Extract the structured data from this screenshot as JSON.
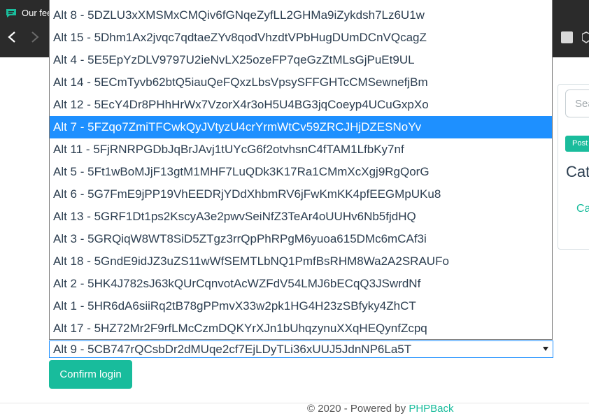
{
  "browser": {
    "tab_title": "Our fee",
    "back_icon": "back-arrow-icon",
    "forward_icon": "forward-arrow-icon"
  },
  "sidebar": {
    "search_placeholder": "Sea",
    "post_button_label": "Post",
    "heading": "Cat",
    "link_text": "Ca"
  },
  "login_select": {
    "options": [
      "Alt 8 - 5DZLU3xXMSMxCMQiv6fGNqeZyfLL2GHMa9iZykdsh7Lz6U1w",
      "Alt 15 - 5Dhm1Ax2jvqc7qdtaeZYv8qodVhzdtVPbHugDUmDCnVQcagZ",
      "Alt 4 - 5E5EpYzDLV9797U2ieNvLX25ozeFP7qeGzZtMLsGjPuEt9UL",
      "Alt 14 - 5ECmTyvb62btQ5iauQeFQxzLbsVpsySFFGHTcCMSewnefjBm",
      "Alt 12 - 5EcY4Dr8PHhHrWx7VzorX4r3oH5U4BG3jqCoeyp4UCuGxpXo",
      "Alt 7 - 5FZqo7ZmiTFCwkQyJVtyzU4crYrmWtCv59ZRCJHjDZESNoYv",
      "Alt 11 - 5FjRNRPGDbJqBrJAvj1tUYcG6f2otvhsnC4fTAM1LfbKy7nf",
      "Alt 5 - 5Ft1wBoMJjF13gtM1MHF7LuQDk3K17Ra1CMmXcXgj9RgQorG",
      "Alt 6 - 5G7FmE9jPP19VhEEDRjYDdXhbmRV6jFwKmKK4pfEEGMpUKu8",
      "Alt 13 - 5GRF1Dt1ps2KscyA3e2pwvSeiNfZ3TeAr4oUUHv6Nb5fjdHQ",
      "Alt 3 - 5GRQiqW8WT8SiD5ZTgz3rrQpPhRPgM6yuoa615DMc6mCAf3i",
      "Alt 18 - 5GndE9idJZ3uZS11wWfSEMTLbNQ1PmfBsRHM8Wa2A2SRAUFo",
      "Alt 2 - 5HK4J782sJ63kQUrCqnvotAcWZFdV54LMJ6bECqQ3JSwrdNf",
      "Alt 1 - 5HR6dA6siiRq2tB78gPPmvX33w2pk1HG4H23zSBfyky4ZhCT",
      "Alt 17 - 5HZ72Mr2F9rfLMcCzmDQKYrXJn1bUhqzynuXXqHEQynfZcpq"
    ],
    "highlighted_option": "Alt 7 - 5FZqo7ZmiTFCwkQyJVtyzU4crYrmWtCv59ZRCJHjDZESNoYv",
    "selected_value": "Alt 9 - 5CB747rQCsbDr2dMUqe2cf7EjLDyTLi36xUUJ5JdnNP6La5T",
    "arrow_icon": "dropdown-arrow-icon"
  },
  "confirm_button_label": "Confirm login",
  "footer": {
    "prefix": "© 2020 - Powered by ",
    "link_text": "PHPBack"
  },
  "colors": {
    "accent": "#18bc9c",
    "highlight": "#1e90ff",
    "chrome": "#2b2b2b"
  }
}
